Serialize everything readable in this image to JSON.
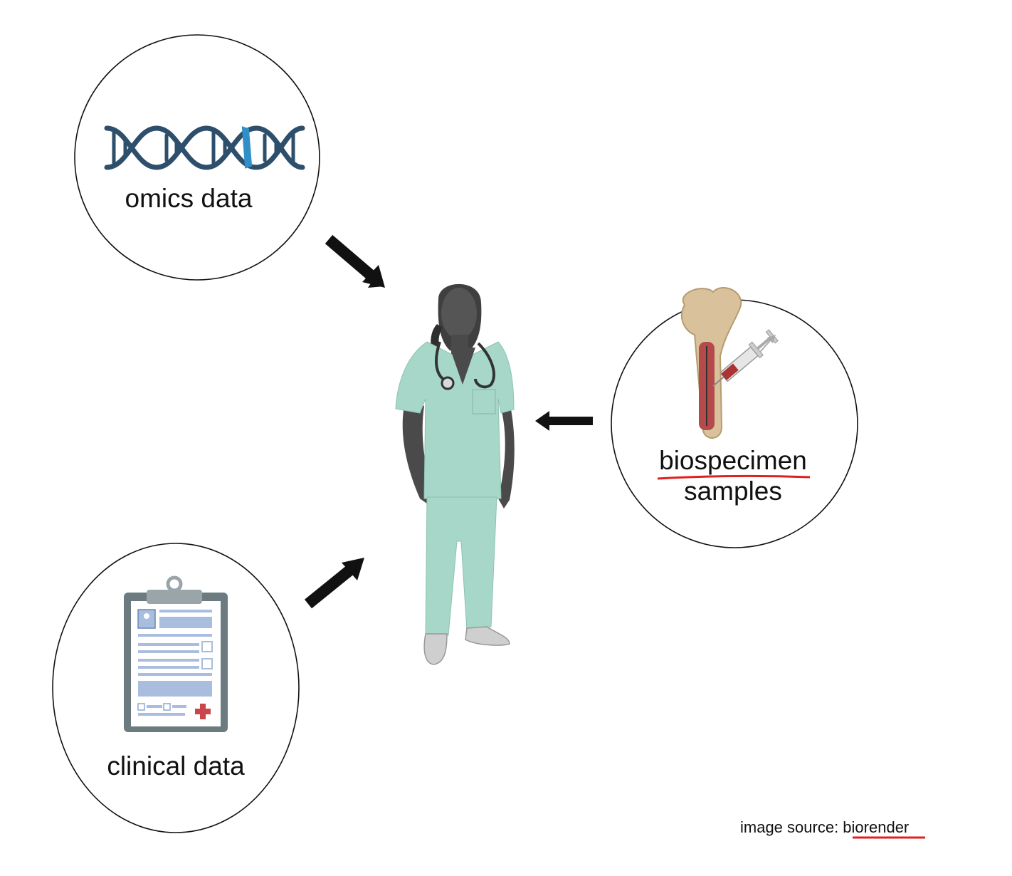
{
  "labels": {
    "omics": "omics data",
    "biospecimen_line1": "biospecimen",
    "biospecimen_line2": "samples",
    "clinical": "clinical data",
    "source_prefix": "image source: ",
    "source_name": "biorender"
  },
  "icons": [
    "dna-icon",
    "doctor-figure",
    "bone-marrow-syringe-icon",
    "clipboard-icon",
    "arrow-icon"
  ],
  "colors": {
    "scrubs": "#a6d7c9",
    "skin": "#4a4a4a",
    "dna_dark": "#2e4f6b",
    "dna_accent": "#2f8fc6",
    "clipboard_frame": "#6b7b80",
    "clipboard_lines": "#a9bedf",
    "underline": "#e02020"
  }
}
